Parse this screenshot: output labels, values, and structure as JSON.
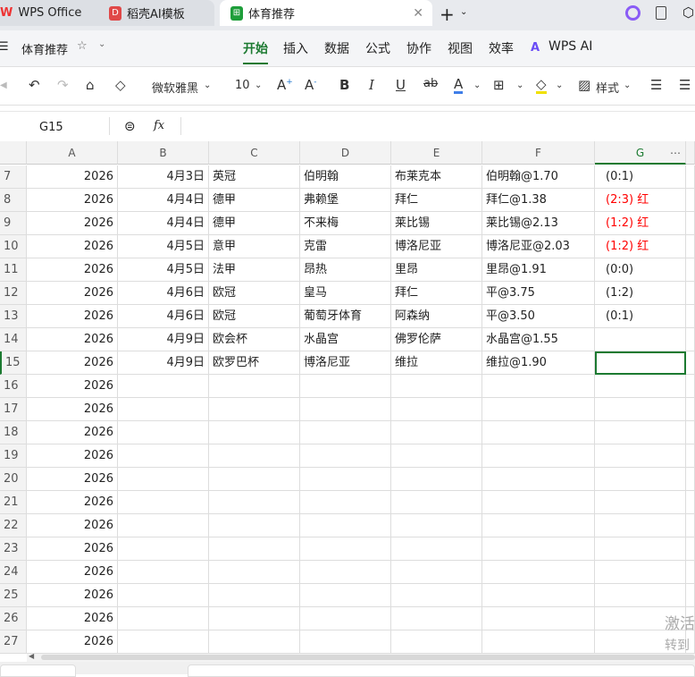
{
  "tabs": [
    {
      "label": "WPS Office",
      "icon": "wps-logo-icon"
    },
    {
      "label": "稻壳AI模板",
      "icon": "docer-icon"
    },
    {
      "label": "体育推荐",
      "icon": "spreadsheet-icon",
      "active": true
    }
  ],
  "doc": {
    "title": "体育推荐"
  },
  "menu": [
    "开始",
    "插入",
    "数据",
    "公式",
    "协作",
    "视图",
    "效率",
    "WPS AI"
  ],
  "toolbar": {
    "font": "微软雅黑",
    "size": "10",
    "style_label": "样式"
  },
  "formula": {
    "cell_ref": "G15",
    "fx": "fx",
    "value": ""
  },
  "columns": [
    "A",
    "B",
    "C",
    "D",
    "E",
    "F",
    "G"
  ],
  "rows": [
    {
      "n": "7",
      "a": "2026",
      "b": "4月3日",
      "c": "英冠",
      "d": "伯明翰",
      "e": "布莱克本",
      "f": "伯明翰@1.70",
      "g": "(0:1)",
      "red": false
    },
    {
      "n": "8",
      "a": "2026",
      "b": "4月4日",
      "c": "德甲",
      "d": "弗赖堡",
      "e": "拜仁",
      "f": "拜仁@1.38",
      "g": "(2:3)  红",
      "red": true
    },
    {
      "n": "9",
      "a": "2026",
      "b": "4月4日",
      "c": "德甲",
      "d": "不来梅",
      "e": "莱比锡",
      "f": "莱比锡@2.13",
      "g": "(1:2)  红",
      "red": true
    },
    {
      "n": "10",
      "a": "2026",
      "b": "4月5日",
      "c": "意甲",
      "d": "克雷",
      "e": "博洛尼亚",
      "f": "博洛尼亚@2.03",
      "g": "(1:2)  红",
      "red": true
    },
    {
      "n": "11",
      "a": "2026",
      "b": "4月5日",
      "c": "法甲",
      "d": "昂热",
      "e": "里昂",
      "f": "里昂@1.91",
      "g": "(0:0)",
      "red": false
    },
    {
      "n": "12",
      "a": "2026",
      "b": "4月6日",
      "c": "欧冠",
      "d": "皇马",
      "e": "拜仁",
      "f": "平@3.75",
      "g": "(1:2)",
      "red": false
    },
    {
      "n": "13",
      "a": "2026",
      "b": "4月6日",
      "c": "欧冠",
      "d": "葡萄牙体育",
      "e": "阿森纳",
      "f": "平@3.50",
      "g": "(0:1)",
      "red": false
    },
    {
      "n": "14",
      "a": "2026",
      "b": "4月9日",
      "c": "欧会杯",
      "d": "水晶宫",
      "e": "佛罗伦萨",
      "f": "水晶宫@1.55",
      "g": "",
      "red": false
    },
    {
      "n": "15",
      "a": "2026",
      "b": "4月9日",
      "c": "欧罗巴杯",
      "d": "博洛尼亚",
      "e": "维拉",
      "f": "维拉@1.90",
      "g": "",
      "red": false
    },
    {
      "n": "16",
      "a": "2026"
    },
    {
      "n": "17",
      "a": "2026"
    },
    {
      "n": "18",
      "a": "2026"
    },
    {
      "n": "19",
      "a": "2026"
    },
    {
      "n": "20",
      "a": "2026"
    },
    {
      "n": "21",
      "a": "2026"
    },
    {
      "n": "22",
      "a": "2026"
    },
    {
      "n": "23",
      "a": "2026"
    },
    {
      "n": "24",
      "a": "2026"
    },
    {
      "n": "25",
      "a": "2026"
    },
    {
      "n": "26",
      "a": "2026"
    },
    {
      "n": "27",
      "a": "2026"
    }
  ],
  "watermark": {
    "line1": "激活",
    "line2": "转到"
  },
  "colors": {
    "accent": "#1c7a31",
    "red": "#ff0000"
  }
}
